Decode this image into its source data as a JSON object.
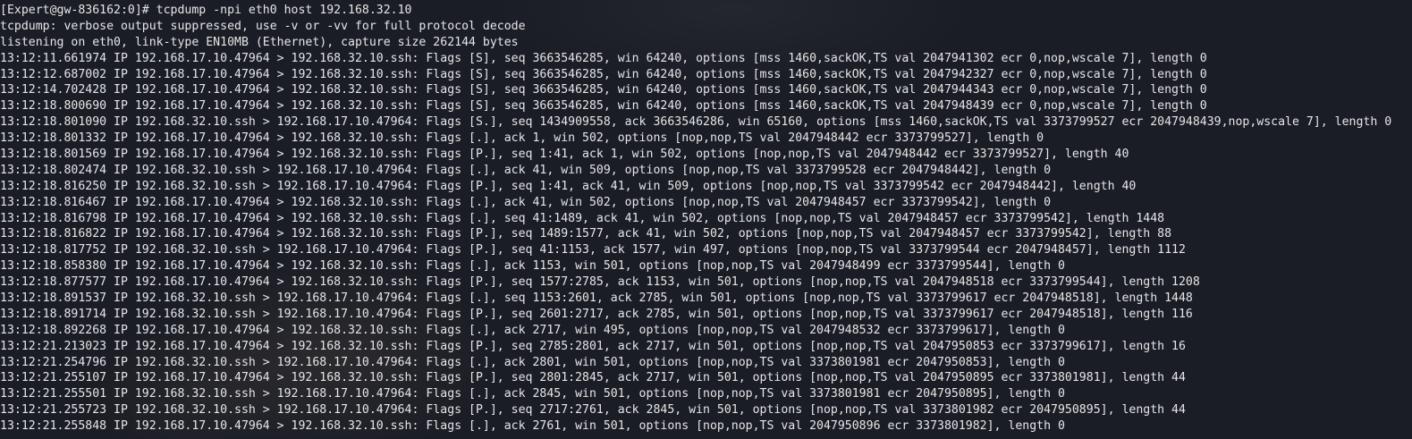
{
  "terminal": {
    "lines": [
      "[Expert@gw-836162:0]# tcpdump -npi eth0 host 192.168.32.10",
      "tcpdump: verbose output suppressed, use -v or -vv for full protocol decode",
      "listening on eth0, link-type EN10MB (Ethernet), capture size 262144 bytes",
      "13:12:11.661974 IP 192.168.17.10.47964 > 192.168.32.10.ssh: Flags [S], seq 3663546285, win 64240, options [mss 1460,sackOK,TS val 2047941302 ecr 0,nop,wscale 7], length 0",
      "13:12:12.687002 IP 192.168.17.10.47964 > 192.168.32.10.ssh: Flags [S], seq 3663546285, win 64240, options [mss 1460,sackOK,TS val 2047942327 ecr 0,nop,wscale 7], length 0",
      "13:12:14.702428 IP 192.168.17.10.47964 > 192.168.32.10.ssh: Flags [S], seq 3663546285, win 64240, options [mss 1460,sackOK,TS val 2047944343 ecr 0,nop,wscale 7], length 0",
      "13:12:18.800690 IP 192.168.17.10.47964 > 192.168.32.10.ssh: Flags [S], seq 3663546285, win 64240, options [mss 1460,sackOK,TS val 2047948439 ecr 0,nop,wscale 7], length 0",
      "13:12:18.801090 IP 192.168.32.10.ssh > 192.168.17.10.47964: Flags [S.], seq 1434909558, ack 3663546286, win 65160, options [mss 1460,sackOK,TS val 3373799527 ecr 2047948439,nop,wscale 7], length 0",
      "13:12:18.801332 IP 192.168.17.10.47964 > 192.168.32.10.ssh: Flags [.], ack 1, win 502, options [nop,nop,TS val 2047948442 ecr 3373799527], length 0",
      "13:12:18.801569 IP 192.168.17.10.47964 > 192.168.32.10.ssh: Flags [P.], seq 1:41, ack 1, win 502, options [nop,nop,TS val 2047948442 ecr 3373799527], length 40",
      "13:12:18.802474 IP 192.168.32.10.ssh > 192.168.17.10.47964: Flags [.], ack 41, win 509, options [nop,nop,TS val 3373799528 ecr 2047948442], length 0",
      "13:12:18.816250 IP 192.168.32.10.ssh > 192.168.17.10.47964: Flags [P.], seq 1:41, ack 41, win 509, options [nop,nop,TS val 3373799542 ecr 2047948442], length 40",
      "13:12:18.816467 IP 192.168.17.10.47964 > 192.168.32.10.ssh: Flags [.], ack 41, win 502, options [nop,nop,TS val 2047948457 ecr 3373799542], length 0",
      "13:12:18.816798 IP 192.168.17.10.47964 > 192.168.32.10.ssh: Flags [.], seq 41:1489, ack 41, win 502, options [nop,nop,TS val 2047948457 ecr 3373799542], length 1448",
      "13:12:18.816822 IP 192.168.17.10.47964 > 192.168.32.10.ssh: Flags [P.], seq 1489:1577, ack 41, win 502, options [nop,nop,TS val 2047948457 ecr 3373799542], length 88",
      "13:12:18.817752 IP 192.168.32.10.ssh > 192.168.17.10.47964: Flags [P.], seq 41:1153, ack 1577, win 497, options [nop,nop,TS val 3373799544 ecr 2047948457], length 1112",
      "13:12:18.858380 IP 192.168.17.10.47964 > 192.168.32.10.ssh: Flags [.], ack 1153, win 501, options [nop,nop,TS val 2047948499 ecr 3373799544], length 0",
      "13:12:18.877577 IP 192.168.17.10.47964 > 192.168.32.10.ssh: Flags [P.], seq 1577:2785, ack 1153, win 501, options [nop,nop,TS val 2047948518 ecr 3373799544], length 1208",
      "13:12:18.891537 IP 192.168.32.10.ssh > 192.168.17.10.47964: Flags [.], seq 1153:2601, ack 2785, win 501, options [nop,nop,TS val 3373799617 ecr 2047948518], length 1448",
      "13:12:18.891714 IP 192.168.32.10.ssh > 192.168.17.10.47964: Flags [P.], seq 2601:2717, ack 2785, win 501, options [nop,nop,TS val 3373799617 ecr 2047948518], length 116",
      "13:12:18.892268 IP 192.168.17.10.47964 > 192.168.32.10.ssh: Flags [.], ack 2717, win 495, options [nop,nop,TS val 2047948532 ecr 3373799617], length 0",
      "13:12:21.213023 IP 192.168.17.10.47964 > 192.168.32.10.ssh: Flags [P.], seq 2785:2801, ack 2717, win 501, options [nop,nop,TS val 2047950853 ecr 3373799617], length 16",
      "13:12:21.254796 IP 192.168.32.10.ssh > 192.168.17.10.47964: Flags [.], ack 2801, win 501, options [nop,nop,TS val 3373801981 ecr 2047950853], length 0",
      "13:12:21.255107 IP 192.168.17.10.47964 > 192.168.32.10.ssh: Flags [P.], seq 2801:2845, ack 2717, win 501, options [nop,nop,TS val 2047950895 ecr 3373801981], length 44",
      "13:12:21.255501 IP 192.168.32.10.ssh > 192.168.17.10.47964: Flags [.], ack 2845, win 501, options [nop,nop,TS val 3373801981 ecr 2047950895], length 0",
      "13:12:21.255723 IP 192.168.32.10.ssh > 192.168.17.10.47964: Flags [P.], seq 2717:2761, ack 2845, win 501, options [nop,nop,TS val 3373801982 ecr 2047950895], length 44",
      "13:12:21.255848 IP 192.168.17.10.47964 > 192.168.32.10.ssh: Flags [.], ack 2761, win 501, options [nop,nop,TS val 2047950896 ecr 3373801982], length 0"
    ]
  }
}
